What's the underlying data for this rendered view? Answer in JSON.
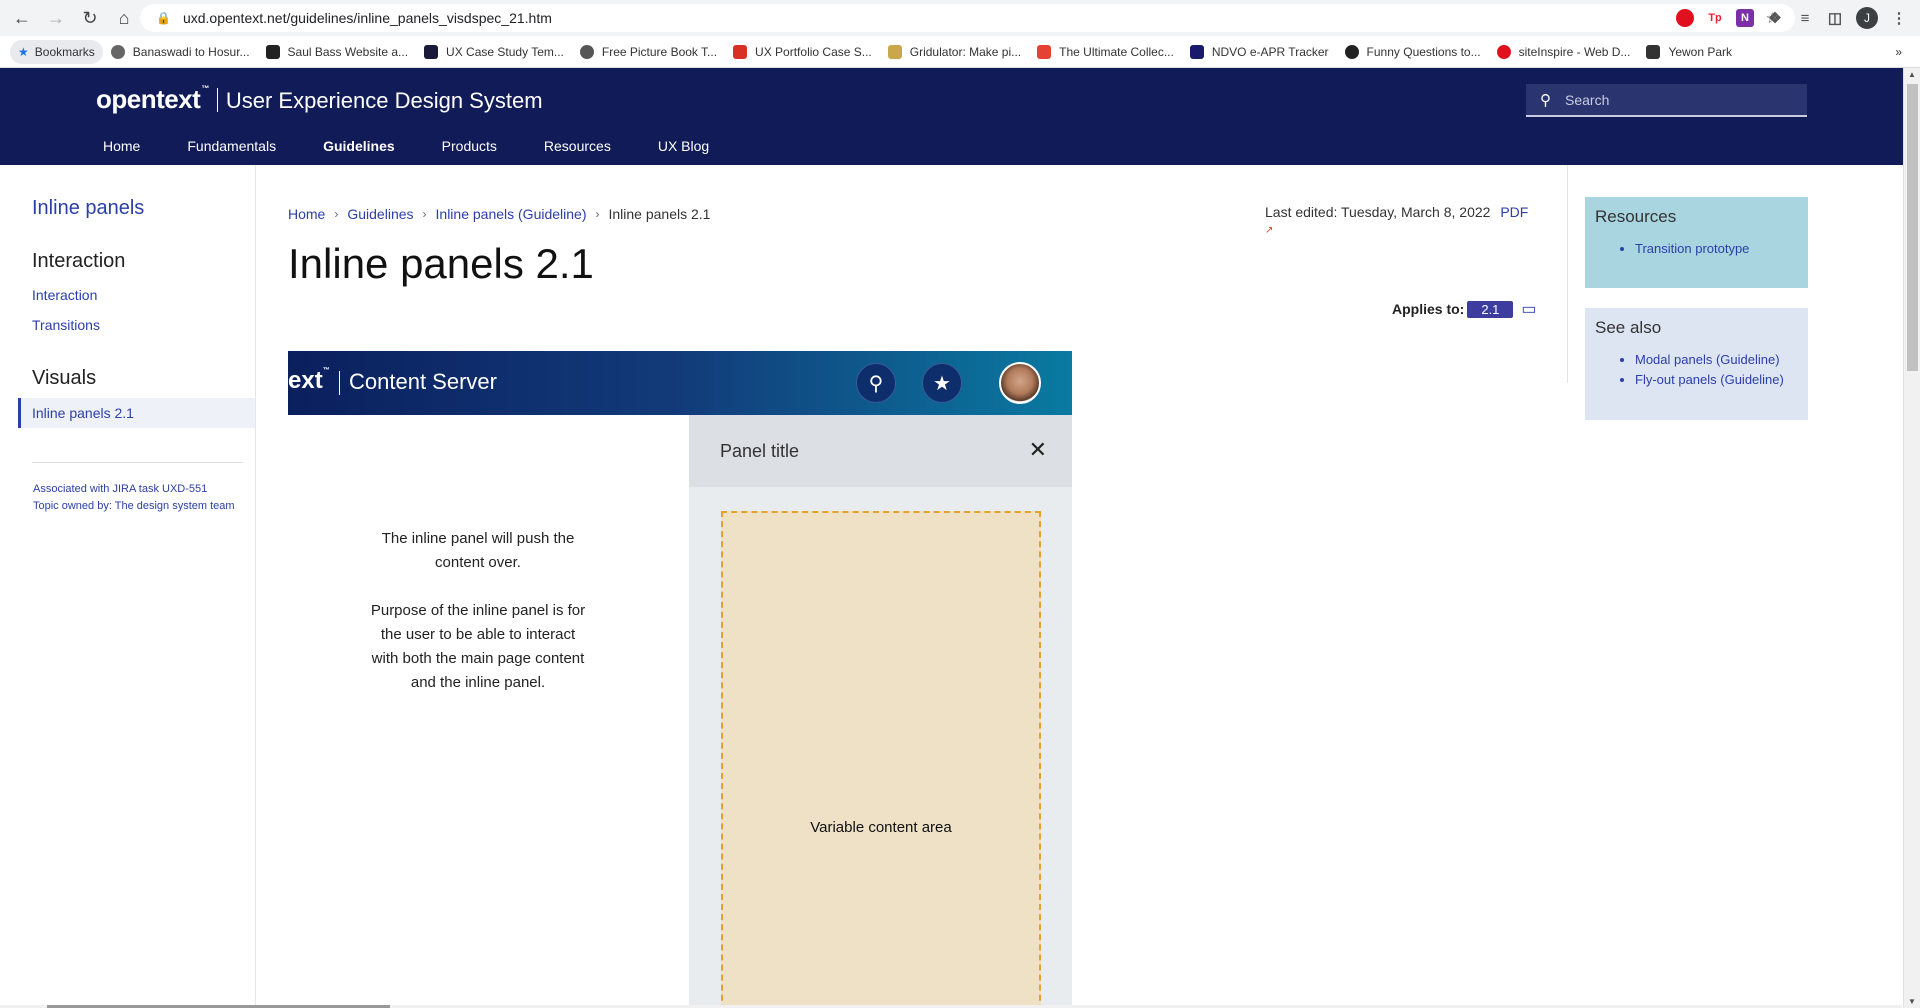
{
  "browser": {
    "url": "uxd.opentext.net/guidelines/inline_panels_visdspec_21.htm",
    "profile_initial": "J",
    "bookmarks": [
      "Bookmarks",
      "Banaswadi to Hosur...",
      "Saul Bass Website a...",
      "UX Case Study Tem...",
      "Free Picture Book T...",
      "UX Portfolio Case S...",
      "Gridulator: Make pi...",
      "The Ultimate Collec...",
      "NDVO e-APR Tracker",
      "Funny Questions to...",
      "siteInspire - Web D...",
      "Yewon Park"
    ],
    "ext_labels": [
      "Tp",
      "N"
    ]
  },
  "site": {
    "logo": "opentext",
    "logo_tm": "™",
    "title": "User Experience Design System",
    "search_placeholder": "Search",
    "nav": [
      "Home",
      "Fundamentals",
      "Guidelines",
      "Products",
      "Resources",
      "UX Blog"
    ],
    "active_nav": "Guidelines"
  },
  "left_nav": {
    "title": "Inline panels",
    "sections": [
      {
        "heading": "Interaction",
        "links": [
          "Interaction",
          "Transitions"
        ]
      },
      {
        "heading": "Visuals",
        "links": [
          "Inline panels 2.1"
        ]
      }
    ],
    "meta_line1_prefix": "Associated with ",
    "meta_line1_link": "JIRA task UXD-551",
    "meta_line2": "Topic owned by: The design system team"
  },
  "main": {
    "breadcrumbs": [
      "Home",
      "Guidelines",
      "Inline panels (Guideline)"
    ],
    "breadcrumb_current": "Inline panels 2.1",
    "last_edited": "Last edited: Tuesday, March 8, 2022",
    "pdf_label": "PDF",
    "title": "Inline panels 2.1",
    "applies_label": "Applies to:",
    "applies_version": "2.1"
  },
  "mockup": {
    "logo_partial": "ext",
    "logo_tm": "™",
    "app_title": "Content Server",
    "text_block1": "The inline panel will push the content over.",
    "text_block2": "Purpose of the inline panel is for the user to be able to interact with both the main page content and the inline panel.",
    "panel_title": "Panel title",
    "variable_area": "Variable content area"
  },
  "sidebar": {
    "resources_title": "Resources",
    "resources_links": [
      "Transition prototype"
    ],
    "see_also_title": "See also",
    "see_also_links": [
      "Modal panels (Guideline)",
      "Fly-out panels (Guideline)"
    ]
  },
  "colors": {
    "header_bg": "#111b58",
    "link": "#2b3fa8",
    "resources_bg": "#a8d5e0",
    "see_also_bg": "#dde4f2",
    "badge": "#3d3d9f",
    "variable_area_bg": "#eee1c6",
    "variable_area_border": "#e3a32a"
  },
  "icons": [
    "back-icon",
    "forward-icon",
    "reload-icon",
    "home-icon",
    "lock-icon",
    "share-icon",
    "star-icon",
    "search-icon",
    "close-icon",
    "monitor-icon",
    "external-link-icon"
  ]
}
